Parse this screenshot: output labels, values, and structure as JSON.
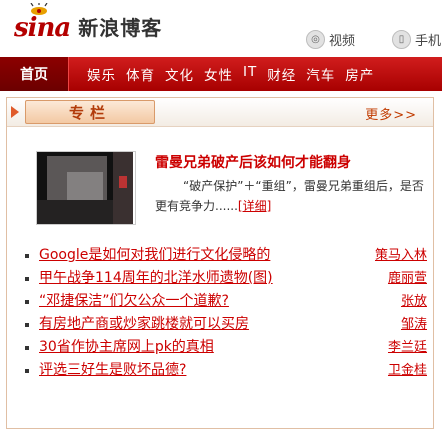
{
  "header": {
    "logo_text": "sina",
    "logo_title": "新浪博客",
    "links": [
      {
        "icon": "video-icon",
        "label": "视频"
      },
      {
        "icon": "mobile-icon",
        "label": "手机"
      }
    ]
  },
  "nav": {
    "home": "首页",
    "items": [
      "娱乐",
      "体育",
      "文化",
      "女性",
      "IT",
      "财经",
      "汽车",
      "房产"
    ]
  },
  "module": {
    "title": "专栏",
    "more": "更多>>",
    "feature": {
      "title": "雷曼兄弟破产后该如何才能翻身",
      "desc": "“破产保护”＋“重组”，雷曼兄弟重组后，是否更有竞争力......",
      "detail": "[详细]"
    },
    "articles": [
      {
        "title": "Google是如何对我们进行文化侵略的",
        "source": "策马入林"
      },
      {
        "title": "甲午战争114周年的北洋水师遗物(图)",
        "source": "鹿丽萱"
      },
      {
        "title": "“邓捷保洁”们欠公众一个道歉?",
        "source": "张放"
      },
      {
        "title": "有房地产商或炒家跳楼就可以买房",
        "source": "邹涛"
      },
      {
        "title": "30省作协主席网上pk的真相",
        "source": "李兰廷"
      },
      {
        "title": "评选三好生是败坏品德?",
        "source": "卫金桂"
      }
    ]
  },
  "colors": {
    "brand": "#c00000",
    "accent": "#c13b00"
  }
}
